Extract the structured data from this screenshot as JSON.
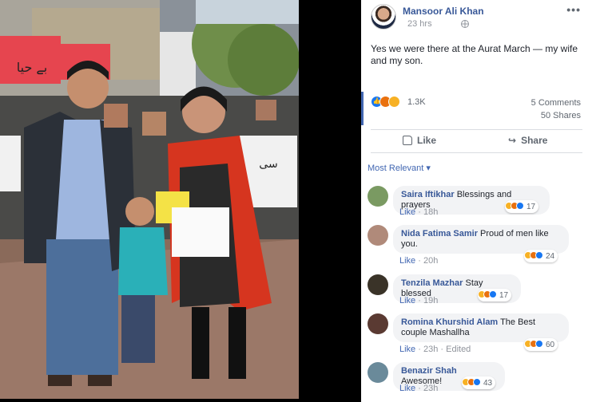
{
  "post": {
    "author": "Mansoor Ali Khan",
    "time": "23 hrs",
    "text": "Yes we were there at the Aurat March — my wife and my son.",
    "reactions_count": "1.3K",
    "comments_count": "5 Comments",
    "shares_count": "50 Shares",
    "like_label": "Like",
    "share_label": "Share",
    "sort_label": "Most Relevant"
  },
  "comments": [
    {
      "name": "Saira Iftikhar",
      "text": "Blessings and prayers",
      "like": "Like",
      "time": "18h",
      "edited": "",
      "reactions": "17"
    },
    {
      "name": "Nida Fatima Samir",
      "text": "Proud of men like you.",
      "like": "Like",
      "time": "20h",
      "edited": "",
      "reactions": "24"
    },
    {
      "name": "Tenzila Mazhar",
      "text": "Stay blessed",
      "like": "Like",
      "time": "19h",
      "edited": "",
      "reactions": "17"
    },
    {
      "name": "Romina Khurshid Alam",
      "text": "The Best couple Mashallha",
      "like": "Like",
      "time": "23h",
      "edited": "Edited",
      "reactions": "60"
    },
    {
      "name": "Benazir Shah",
      "text": "Awesome!",
      "like": "Like",
      "time": "23h",
      "edited": "",
      "reactions": "43"
    }
  ],
  "photo_signs": {
    "sign1": "بے حیا",
    "sign2": "سی"
  },
  "colors": {
    "link": "#385898",
    "accent": "#4267b2",
    "like": "#1877f2",
    "angry": "#e9710f",
    "haha": "#f7b125"
  }
}
